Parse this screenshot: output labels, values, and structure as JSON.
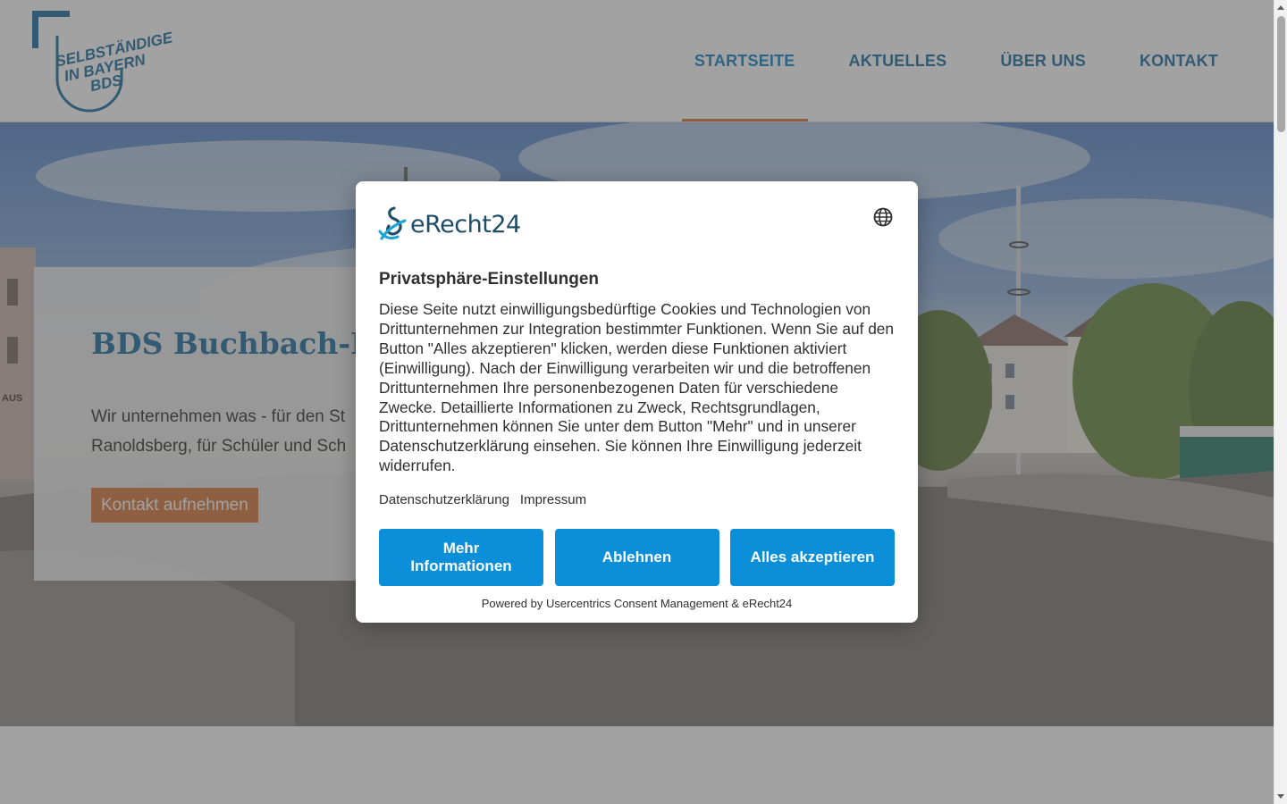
{
  "header": {
    "logo": {
      "line1": "SELBSTÄNDIGE",
      "line2": "IN BAYERN",
      "line3": "BDS"
    },
    "nav": [
      {
        "label": "STARTSEITE",
        "active": true
      },
      {
        "label": "AKTUELLES",
        "active": false
      },
      {
        "label": "ÜBER UNS",
        "active": false
      },
      {
        "label": "KONTAKT",
        "active": false
      }
    ]
  },
  "hero": {
    "title": "BDS Buchbach-Ra",
    "text_line1": "Wir unternehmen was - für den St",
    "text_line2": "Ranoldsberg, für Schüler und Sch",
    "cta_label": "Kontakt aufnehmen",
    "scene_sign": "AUS"
  },
  "consent": {
    "brand_name": "eRecht24",
    "language_icon": "globe-icon",
    "title": "Privatsphäre-Einstellungen",
    "text": "Diese Seite nutzt einwilligungsbedürftige Cookies und Technologien von Drittunternehmen zur Integration bestimmter Funktionen. Wenn Sie auf den Button \"Alles akzeptieren\" klicken, werden diese Funktionen aktiviert (Einwilligung). Nach der Einwilligung verarbeiten wir und die betroffenen Drittunternehmen Ihre personenbezogenen Daten für verschiedene Zwecke. Detaillierte Informationen zu Zweck, Rechtsgrundlagen, Drittunternehmen können Sie unter dem Button \"Mehr\" und in unserer Datenschutzerklärung einsehen. Sie können Ihre Einwilligung jederzeit widerrufen.",
    "links": {
      "privacy": "Datenschutzerklärung",
      "imprint": "Impressum"
    },
    "buttons": {
      "more": "Mehr Informationen",
      "decline": "Ablehnen",
      "accept_all": "Alles akzeptieren"
    },
    "powered_by": "Powered by Usercentrics Consent Management & eRecht24"
  },
  "colors": {
    "brand_blue": "#1f6fa0",
    "accent_orange": "#d9783d",
    "consent_button": "#0a8fd8"
  }
}
